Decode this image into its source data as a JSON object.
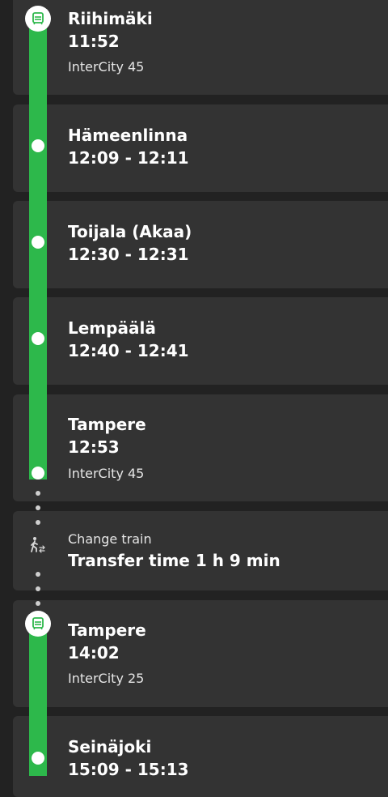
{
  "theme": {
    "background": "#222222",
    "card": "#333333",
    "line_green": "#2db84b"
  },
  "stops": [
    {
      "station": "Riihimäki",
      "time": "11:52",
      "train": "InterCity 45"
    },
    {
      "station": "Hämeenlinna",
      "time": "12:09 - 12:11"
    },
    {
      "station": "Toijala (Akaa)",
      "time": "12:30 - 12:31"
    },
    {
      "station": "Lempäälä",
      "time": "12:40 - 12:41"
    },
    {
      "station": "Tampere",
      "time": "12:53",
      "train": "InterCity 45"
    },
    {
      "station": "Tampere",
      "time": "14:02",
      "train": "InterCity 25"
    },
    {
      "station": "Seinäjoki",
      "time": "15:09 - 15:13"
    }
  ],
  "transfer": {
    "label": "Change train",
    "duration": "Transfer time 1 h 9 min",
    "icon": "walking-person-icon"
  },
  "icons": {
    "train": "train-icon"
  }
}
